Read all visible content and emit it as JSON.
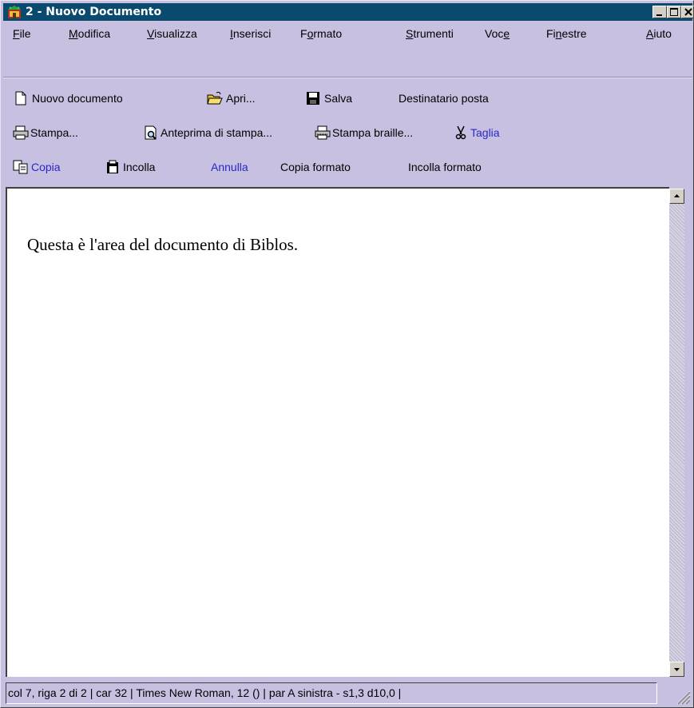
{
  "window": {
    "title": "2 - Nuovo Documento",
    "app_icon": "biblos-app-icon",
    "controls": [
      "minimize-icon",
      "maximize-icon",
      "close-icon"
    ]
  },
  "menubar": {
    "items": [
      {
        "label": "File",
        "key": "F"
      },
      {
        "label": "Modifica",
        "key": "M"
      },
      {
        "label": "Visualizza",
        "key": "V"
      },
      {
        "label": "Inserisci",
        "key": "I"
      },
      {
        "label": "Formato",
        "key": "o"
      },
      {
        "label": "Strumenti",
        "key": "S"
      },
      {
        "label": "Voce",
        "key": "e"
      },
      {
        "label": "Finestre",
        "key": "n"
      },
      {
        "label": "Aiuto",
        "key": "A"
      }
    ]
  },
  "toolbar": {
    "new_document": "Nuovo documento",
    "open": "Apri...",
    "save": "Salva",
    "mail_recipient": "Destinatario posta",
    "print": "Stampa...",
    "print_preview": "Anteprima di stampa...",
    "braille_print": "Stampa braille...",
    "cut": "Taglia",
    "copy": "Copia",
    "paste": "Incolla",
    "undo": "Annulla",
    "copy_format": "Copia formato",
    "paste_format": "Incolla formato",
    "icons": [
      "new-document-icon",
      "open-folder-icon",
      "save-disk-icon",
      "printer-icon",
      "print-preview-icon",
      "braille-printer-icon",
      "scissors-icon",
      "copy-icon",
      "clipboard-paste-icon"
    ]
  },
  "document": {
    "text": "Questa è l'area del documento di Biblos."
  },
  "statusbar": {
    "text": "col 7, riga 2 di 2 | car 32 | Times New Roman, 12 () | par A sinistra - s1,3 d10,0 |"
  },
  "colors": {
    "titlebar": "#0b4a6f",
    "chrome": "#c8c0e0",
    "disabled_text": "#2828c8"
  }
}
